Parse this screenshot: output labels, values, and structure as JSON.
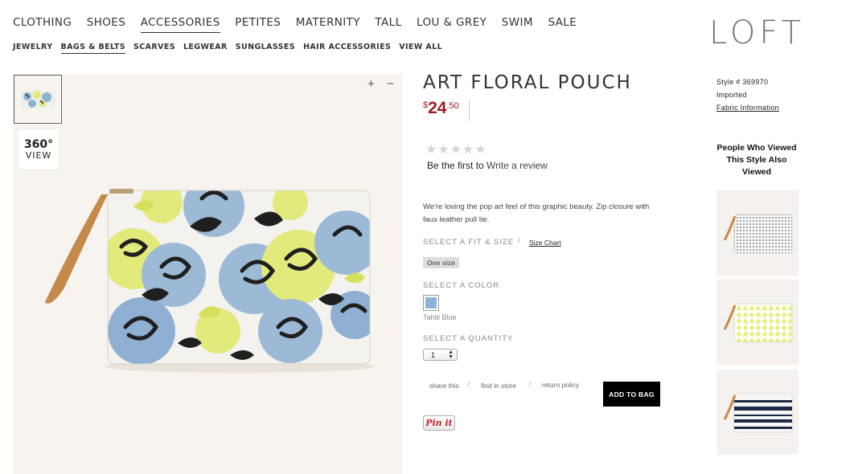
{
  "brand": {
    "logo": "LOFT"
  },
  "main_nav": [
    {
      "label": "CLOTHING",
      "active": false
    },
    {
      "label": "SHOES",
      "active": false
    },
    {
      "label": "ACCESSORIES",
      "active": true
    },
    {
      "label": "PETITES",
      "active": false
    },
    {
      "label": "MATERNITY",
      "active": false
    },
    {
      "label": "TALL",
      "active": false
    },
    {
      "label": "LOU & GREY",
      "active": false
    },
    {
      "label": "SWIM",
      "active": false
    },
    {
      "label": "SALE",
      "active": false
    }
  ],
  "sub_nav": [
    {
      "label": "JEWELRY",
      "active": false
    },
    {
      "label": "BAGS & BELTS",
      "active": true
    },
    {
      "label": "SCARVES",
      "active": false
    },
    {
      "label": "LEGWEAR",
      "active": false
    },
    {
      "label": "SUNGLASSES",
      "active": false
    },
    {
      "label": "HAIR ACCESSORIES",
      "active": false
    },
    {
      "label": "VIEW ALL",
      "active": false
    }
  ],
  "gallery": {
    "view360_big": "360°",
    "view360_small": "VIEW",
    "zoom_in": "+",
    "zoom_out": "−"
  },
  "product": {
    "title": "ART FLORAL POUCH",
    "price_currency": "$",
    "price_whole": "24",
    "price_cents": ".50",
    "rating": 0,
    "rating_max": 5,
    "review_prefix": "Be the first to ",
    "review_link": "Write a review",
    "description": "We're loving the pop art feel of this graphic beauty. Zip closure with faux leather pull tie.",
    "fit_label": "SELECT A FIT & SIZE",
    "size_chart": "Size Chart",
    "size_option": "One size",
    "color_label": "SELECT A COLOR",
    "color_name": "Tahiti Blue",
    "color_hex": "#8bb4d8",
    "quantity_label": "SELECT A QUANTITY",
    "quantity": "1",
    "share": "share this",
    "find_store": "find in store",
    "return_policy": "return policy",
    "add_to_bag": "ADD TO BAG",
    "pinit": "Pin it"
  },
  "meta": {
    "style": "Style # 369970",
    "imported": "Imported",
    "fabric": "Fabric Information"
  },
  "recommendations": {
    "title": "People Who Viewed This Style Also Viewed",
    "items": [
      {
        "pattern": "dots-navy"
      },
      {
        "pattern": "dots-yellow"
      },
      {
        "pattern": "stripes-navy"
      }
    ]
  },
  "colors": {
    "price": "#9b1c1c",
    "button": "#000000",
    "pinit": "#c8232c"
  }
}
